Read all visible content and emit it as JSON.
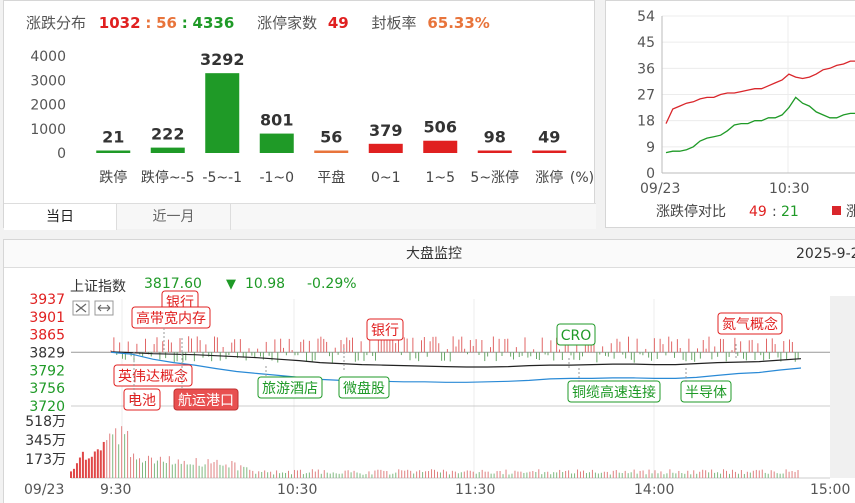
{
  "distribution": {
    "summary": {
      "rise_fall_label": "涨跌分布",
      "rise_count": "1032",
      "flat_count": "56",
      "fall_count": "4336",
      "sep": ":",
      "limit_up_label": "涨停家数",
      "limit_up_count": "49",
      "seal_rate_label": "封板率",
      "seal_rate_value": "65.33%"
    },
    "tabs": [
      "当日",
      "近一月"
    ],
    "unit": "(%)"
  },
  "chart_data": [
    {
      "type": "bar",
      "categories": [
        "跌停",
        "跌停~-5",
        "-5~-1",
        "-1~0",
        "平盘",
        "0~1",
        "1~5",
        "5~涨停",
        "涨停"
      ],
      "values": [
        21,
        222,
        3292,
        801,
        56,
        379,
        506,
        98,
        49
      ],
      "title": "",
      "xlabel": "(%)",
      "ylabel": "",
      "ylim": [
        0,
        4000
      ],
      "yticks": [
        0,
        1000,
        2000,
        3000,
        4000
      ],
      "bar_colors": [
        "#1f9a27",
        "#1f9a27",
        "#1f9a27",
        "#1f9a27",
        "#e8743b",
        "#e02020",
        "#e02020",
        "#e02020",
        "#e02020"
      ],
      "grid": false
    },
    {
      "type": "line",
      "title": "",
      "xticks": [
        "09/23",
        "10:30"
      ],
      "yticks": [
        0,
        9,
        18,
        27,
        36,
        45,
        54
      ],
      "ylim": [
        0,
        54
      ],
      "series": [
        {
          "name": "",
          "color": "#d9262b",
          "values": [
            17,
            22,
            23,
            24,
            24.5,
            25.5,
            26,
            26,
            27,
            27.5,
            27.5,
            28,
            28.5,
            29,
            29,
            30,
            31,
            32,
            34,
            33,
            32.5,
            33,
            34,
            35.5,
            36,
            37,
            37.5,
            38.5,
            38.5,
            38.5
          ]
        },
        {
          "name": "",
          "color": "#1f9a27",
          "values": [
            7,
            7.5,
            7.5,
            8,
            9,
            11,
            12,
            12.5,
            13,
            14.5,
            16.5,
            17,
            17,
            18,
            18,
            19,
            19,
            20,
            22.5,
            26,
            24,
            23,
            21,
            20,
            19,
            19,
            20,
            20.5,
            20.5,
            21
          ]
        }
      ],
      "legend": {
        "label": "涨跌停对比",
        "value_up": "49",
        "value_sep": ":",
        "value_down": "21",
        "extra": "涨"
      }
    },
    {
      "type": "line",
      "title": "大盘监控",
      "date": "2025-9-2",
      "index_name": "上证指数",
      "index_value": "3817.60",
      "index_change": "10.98",
      "index_change_pct": "-0.29%",
      "down_arrow": "▼",
      "price_ticks": [
        "3937",
        "3901",
        "3865",
        "3829",
        "3792",
        "3756",
        "3720"
      ],
      "price_tick_values": [
        3937,
        3901,
        3865,
        3829,
        3792,
        3756,
        3720
      ],
      "ylim": [
        3720,
        3937
      ],
      "volume_ticks": [
        "518万",
        "345万",
        "173万"
      ],
      "volume_tick_values": [
        518,
        345,
        173
      ],
      "volume_ylim": [
        0,
        518
      ],
      "xticks": [
        "09/23",
        "9:30",
        "10:30",
        "11:30",
        "14:00",
        "15:00"
      ],
      "series": [
        {
          "name": "",
          "color": "#222222",
          "values": [
            3830,
            3828,
            3826,
            3825,
            3824,
            3822,
            3820,
            3818,
            3815,
            3812,
            3808,
            3806,
            3804,
            3803,
            3802,
            3801,
            3800,
            3799,
            3799,
            3800,
            3802,
            3803,
            3803,
            3804,
            3805,
            3805,
            3804,
            3804,
            3806,
            3808,
            3809,
            3810,
            3813,
            3816
          ]
        },
        {
          "name": "",
          "color": "#2a8ad6",
          "values": [
            3829,
            3825,
            3815,
            3808,
            3803,
            3796,
            3790,
            3786,
            3782,
            3778,
            3774,
            3772,
            3771,
            3770,
            3769,
            3769,
            3768,
            3768,
            3769,
            3770,
            3772,
            3775,
            3776,
            3776,
            3777,
            3777,
            3776,
            3776,
            3778,
            3782,
            3786,
            3788,
            3793,
            3797
          ]
        }
      ],
      "tags": [
        {
          "text": "银行",
          "style": "red-outline"
        },
        {
          "text": "高带宽内存",
          "style": "red-outline"
        },
        {
          "text": "航运港口",
          "style": "red-fill"
        },
        {
          "text": "银行",
          "style": "red-outline"
        },
        {
          "text": "英伟达概念",
          "style": "red-outline"
        },
        {
          "text": "电池",
          "style": "red-outline"
        },
        {
          "text": "旅游酒店",
          "style": "green-outline"
        },
        {
          "text": "微盘股",
          "style": "green-outline"
        },
        {
          "text": "CRO",
          "style": "green-outline"
        },
        {
          "text": "铜缆高速连接",
          "style": "green-outline"
        },
        {
          "text": "半导体",
          "style": "green-outline"
        },
        {
          "text": "氮气概念",
          "style": "red-outline"
        }
      ]
    }
  ],
  "colors": {
    "up": "#e02020",
    "down": "#1f9a27",
    "flat": "#e8743b",
    "border": "#d6d6d6"
  }
}
